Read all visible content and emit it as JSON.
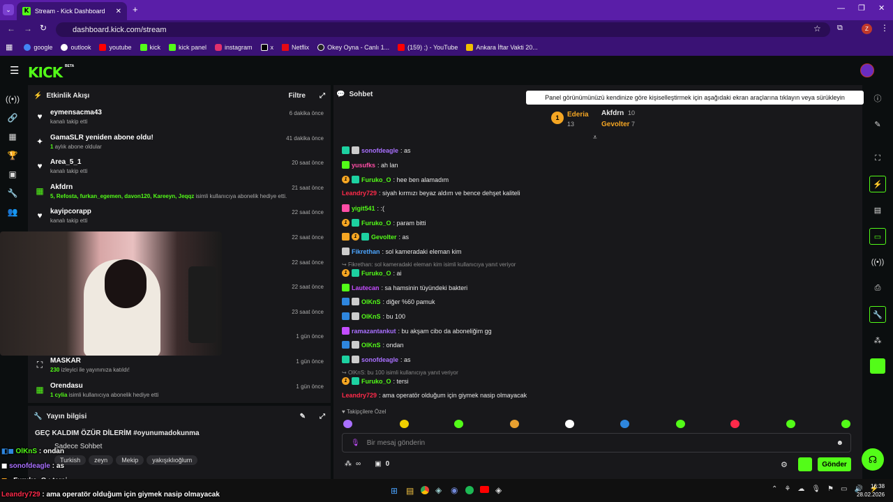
{
  "browser": {
    "tab_title": "Stream - Kick Dashboard",
    "url": "dashboard.kick.com/stream",
    "bookmarks": [
      "google",
      "outlook",
      "youtube",
      "kick",
      "kick panel",
      "instagram",
      "x",
      "Netflix",
      "Okey Oyna - Canlı 1...",
      "(159) ;) - YouTube",
      "Ankara İftar Vakti 20..."
    ],
    "profile_initial": "Z"
  },
  "kick": {
    "logo": "KICK",
    "beta": "BETA"
  },
  "activity": {
    "title": "Etkinlik Akışı",
    "filter": "Filtre",
    "events": [
      {
        "name": "eymensacma43",
        "detail": "kanalı takip etti",
        "time": "6 dakika önce"
      },
      {
        "name": "GamaSLR yeniden abone oldu!",
        "detail_num": "1",
        "detail": " aylık abone oldular",
        "time": "41 dakika önce"
      },
      {
        "name": "Area_5_1",
        "detail": "kanalı takip etti",
        "time": "20 saat önce"
      },
      {
        "name": "Akfdrn",
        "detail_green": "5, Refosta, furkan_egemen, davon120, Kareeyn, Jeqqz",
        "detail": " isimli kullanıcıya abonelik hediye etti.",
        "time": "21 saat önce"
      },
      {
        "name": "kayipcorapp",
        "detail": "kanalı takip etti",
        "time": "22 saat önce"
      },
      {
        "time": "22 saat önce"
      },
      {
        "time": "22 saat önce"
      },
      {
        "time": "22 saat önce"
      },
      {
        "time": "23 saat önce"
      },
      {
        "time": "1 gün önce"
      },
      {
        "name": "MASKAR",
        "detail_num": "230",
        "detail": " izleyici ile yayınınıza katıldı!",
        "time": "1 gün önce"
      },
      {
        "name": "Orendasu",
        "detail_num": "1 cylia",
        "detail": " isimli kullanıcıya abonelik hediye etti",
        "time": "1 gün önce"
      }
    ]
  },
  "stream_info": {
    "title": "Yayın bilgisi",
    "stream_title": "GEÇ KALDIM ÖZÜR DİLERİM #oyunumadokunma",
    "category": "Sadece Sohbet",
    "tags": [
      "Turkish",
      "zeyn",
      "Mekip",
      "yakışıklıoğlum"
    ]
  },
  "chat": {
    "title": "Sohbet",
    "tooltip": "Panel görünümünüzü kendinize göre kişiselleştirmek için aşağıdaki ekran araçlarına tıklayın veya sürükleyin",
    "leaderboard": [
      {
        "name": "Ederia",
        "count": "13",
        "rank": "1"
      },
      {
        "name": "Akfdrn",
        "count": "10"
      },
      {
        "name": "Gevolter",
        "count": "7"
      }
    ],
    "messages": [
      {
        "user": "sonofdeagle",
        "color": "#a970ff",
        "text": ": as"
      },
      {
        "user": "yusufks",
        "color": "#ff4da6",
        "text": ": ah lan"
      },
      {
        "user": "Furuko_O",
        "color": "#53fc18",
        "text": ": hee ben alamadım"
      },
      {
        "user": "Leandry729",
        "color": "#ff2a4a",
        "text": ": siyah kırmızı beyaz aldım ve bence dehşet kaliteli"
      },
      {
        "user": "yigit541",
        "color": "#53fc18",
        "text": ": :("
      },
      {
        "user": "Furuko_O",
        "color": "#53fc18",
        "text": ": param bitti"
      },
      {
        "user": "Gevolter",
        "color": "#53fc18",
        "text": ": as"
      },
      {
        "user": "Fikrethan",
        "color": "#4da6ff",
        "text": ": sol kameradaki eleman kim"
      },
      {
        "reply": "Fikrethan: sol kameradaki eleman kim isimli kullanıcıya yanıt veriyor"
      },
      {
        "user": "Furuko_O",
        "color": "#53fc18",
        "text": ": ai"
      },
      {
        "user": "Lautecan",
        "color": "#c44dff",
        "text": ": sa hamsinin tüyündeki bakteri"
      },
      {
        "user": "OlKnS",
        "color": "#53fc18",
        "text": ": diğer %60 pamuk"
      },
      {
        "user": "OlKnS",
        "color": "#53fc18",
        "text": ": bu 100"
      },
      {
        "user": "ramazantankut",
        "color": "#a970ff",
        "text": ": bu akşam cibo da aboneliğim gg"
      },
      {
        "user": "OlKnS",
        "color": "#53fc18",
        "text": ": ondan"
      },
      {
        "user": "sonofdeagle",
        "color": "#a970ff",
        "text": ": as"
      },
      {
        "reply": "OlKnS: bu 100 isimli kullanıcıya yanıt veriyor"
      },
      {
        "user": "Furuko_O",
        "color": "#53fc18",
        "text": ": tersi"
      },
      {
        "user": "Leandry729",
        "color": "#ff2a4a",
        "text": ": ama operatör olduğum için giymek nasip olmayacak"
      }
    ],
    "emote_label": "Takipçilere Özel",
    "input_placeholder": "Bir mesaj gönderin",
    "send": "Gönder",
    "points": "0"
  },
  "overlay": [
    {
      "user": "OlKnS",
      "text": " : ondan"
    },
    {
      "user": "sonofdeagle",
      "text": " : as"
    },
    {
      "user": "Furuko_O",
      "text": " : tersi"
    },
    {
      "user": "Leandry729",
      "text": " : ama operatör olduğum için giymek nasip olmayacak"
    }
  ],
  "taskbar": {
    "time": "16:38",
    "date": "28.02.2026"
  }
}
